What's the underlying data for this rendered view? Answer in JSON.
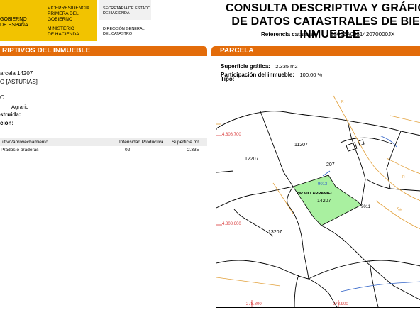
{
  "header": {
    "gov_line1": "GOBIERNO",
    "gov_line2": "DE ESPAÑA",
    "vice_line1": "VICEPRESIDENCIA",
    "vice_line2": "PRIMERA DEL GOBIERNO",
    "min_line1": "MINISTERIO",
    "min_line2": "DE HACIENDA",
    "sec_line1": "SECRETARÍA DE ESTADO",
    "sec_line2": "DE HACIENDA",
    "dir_line1": "DIRECCIÓN GENERAL",
    "dir_line2": "DEL CATASTRO",
    "title_line1": "CONSULTA DESCRIPTIVA Y GRÁFICA",
    "title_line2": "DE DATOS CATASTRALES DE BIEN INMUEBLE",
    "ref_label": "Referencia catastral:",
    "ref_value": "33066A083142070000JX"
  },
  "left_section": {
    "band_title": "RIPTIVOS DEL INMUEBLE",
    "line_parcela": "arcela 14207",
    "line_municipio": "O [ASTURIAS]",
    "line_o": "O",
    "uso_value": "Agrario",
    "construida_label": "struida:",
    "ocupacion_label": "ción:",
    "table": {
      "headers": [
        "ultivo/aprovechamiento",
        "Intensidad Productiva",
        "Superficie m²"
      ],
      "rows": [
        [
          "Prados o praderas",
          "02",
          "2.335"
        ]
      ]
    }
  },
  "parcela": {
    "band_title": "PARCELA",
    "superficie_label": "Superficie gráfica:",
    "superficie_value": "2.335 m2",
    "participacion_label": "Participación del inmueble:",
    "participacion_value": "100,00 %",
    "tipo_label": "Tipo:"
  },
  "map": {
    "parcel_labels": [
      "11207",
      "12207",
      "207",
      "14207",
      "13207",
      "9011",
      "9013"
    ],
    "place_name": "NR VILLARRAMIEL",
    "coord_labels": [
      "4.808.700",
      "4.808.600",
      "278.800",
      "278.900"
    ],
    "highlight_color": "#a9f0a0",
    "road_labels": [
      "R",
      "R",
      "Rio"
    ]
  }
}
